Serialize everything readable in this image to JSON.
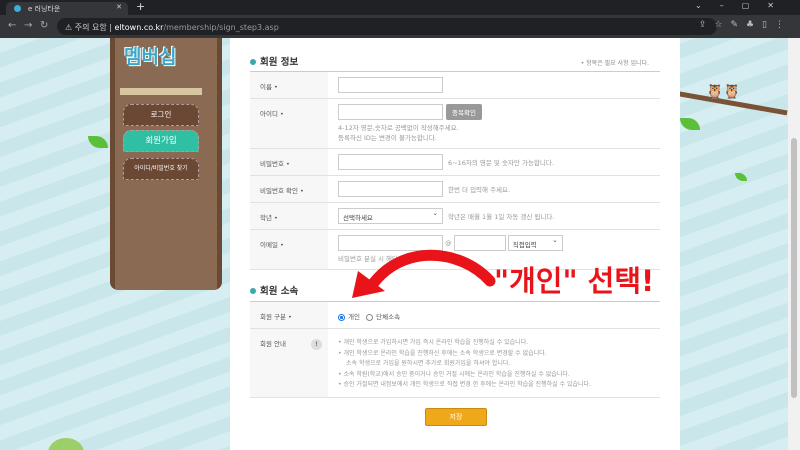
{
  "browser": {
    "tab_title": "e 러닝타운",
    "omnibox_warning": "주의 요함",
    "host": "eltown.co.kr",
    "path": "/membership/sign_step3.asp"
  },
  "sidebar": {
    "logo_text": "멤버십",
    "items": [
      {
        "label": "로그인"
      },
      {
        "label": "회원가입",
        "active": true
      },
      {
        "label": "아이디/비밀번호 찾기"
      }
    ]
  },
  "info": {
    "title": "회원 정보",
    "required_note": "• 항목은 필요 사항 입니다.",
    "name_label": "이름 •",
    "id_label": "아이디 •",
    "id_check_button": "중복확인",
    "id_hint1": "4-12자 영문,숫자로 공백없이 작성해주세요.",
    "id_hint2": "등록하신 ID는 변경이 불가능합니다.",
    "pw_label": "비밀번호 •",
    "pw_hint": "6~16자의 영문 및 숫자만 가능합니다.",
    "pw2_label": "비밀번호 확인 •",
    "pw2_hint": "한번 더 입력해 주세요.",
    "grade_label": "학년 •",
    "grade_select": "선택하세요",
    "grade_hint": "학년은 매월 1월 1일 자동 갱신 됩니다.",
    "email_label": "이메일 •",
    "email_at": "@",
    "email_domain_select": "직접입력",
    "email_hint": "비밀번호 분실 시 해당"
  },
  "affiliation": {
    "title": "회원 소속",
    "type_label": "회원 구분 •",
    "options": [
      "개인",
      "단체소속"
    ],
    "selected": "개인",
    "guide_label": "회원 안내",
    "guide_icon": "!",
    "guide": [
      "개인 학생으로 가입하시면 가입 즉시 온라인 학습을 진행하실 수 있습니다.",
      "개인 학생으로 온라인 학습을 진행하신 후에는 소속 학생으로 변경할 수 없습니다.",
      "소속 학생으로 가입을 원하시면 추가로 회원가입을 하셔야 합니다.",
      "소속 학원(학교)에서 승인 중이거나 승인 거절 시에는 온라인 학습을 진행하실 수 없습니다.",
      "승인 거절되면 내정보에서 개인 학생으로 직접 변경 한 후에는 온라인 학습을 진행하실 수 있습니다."
    ]
  },
  "save_button": "저장",
  "annotation": {
    "text": "\"개인\" 선택!",
    "color": "#e8141a"
  }
}
